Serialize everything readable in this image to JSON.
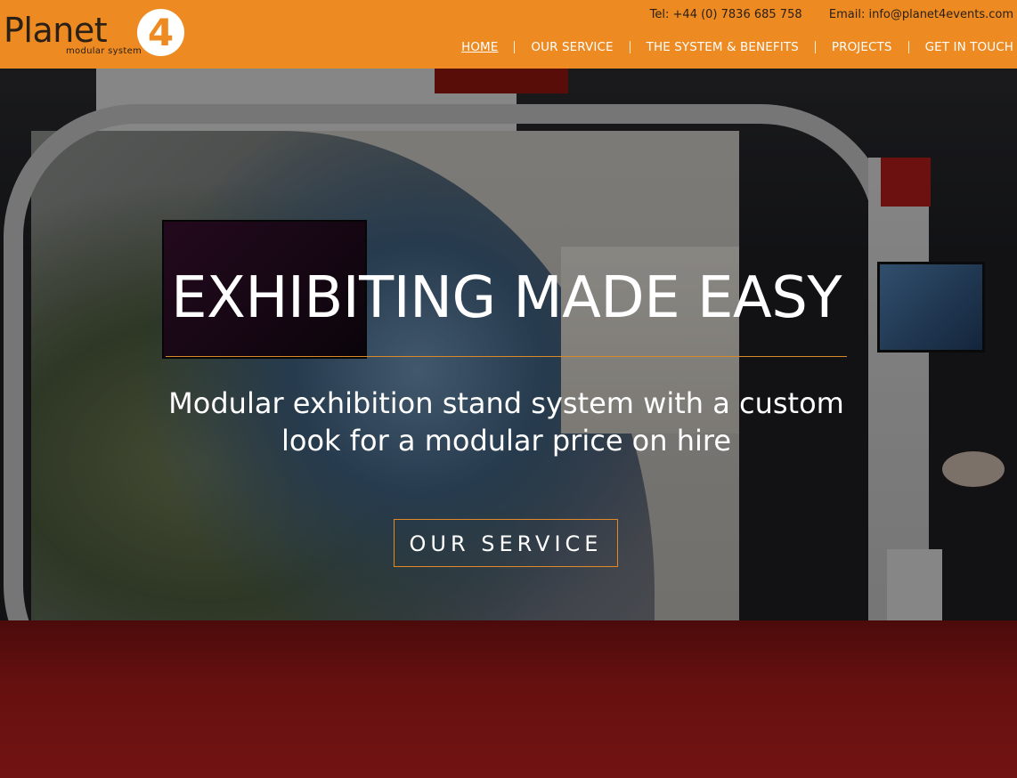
{
  "header": {
    "logo": {
      "word": "Planet",
      "badge": "4",
      "tagline": "modular system"
    },
    "contact": {
      "tel": "Tel: +44 (0) 7836 685 758",
      "email": "Email: info@planet4events.com"
    },
    "nav": [
      {
        "label": "HOME",
        "active": true
      },
      {
        "label": "OUR SERVICE",
        "active": false
      },
      {
        "label": "THE SYSTEM & BENEFITS",
        "active": false
      },
      {
        "label": "PROJECTS",
        "active": false
      },
      {
        "label": "GET IN TOUCH",
        "active": false
      }
    ]
  },
  "hero": {
    "title": "EXHIBITING MADE EASY",
    "subtitle_line1": "Modular exhibition stand system with a custom",
    "subtitle_line2": "look for a modular price on hire",
    "button_label": "OUR SERVICE"
  },
  "colors": {
    "header_bg": "#ee8a22",
    "accent_line": "#d88a2a",
    "text_light": "#ffffff",
    "text_dark": "#2a2015"
  }
}
